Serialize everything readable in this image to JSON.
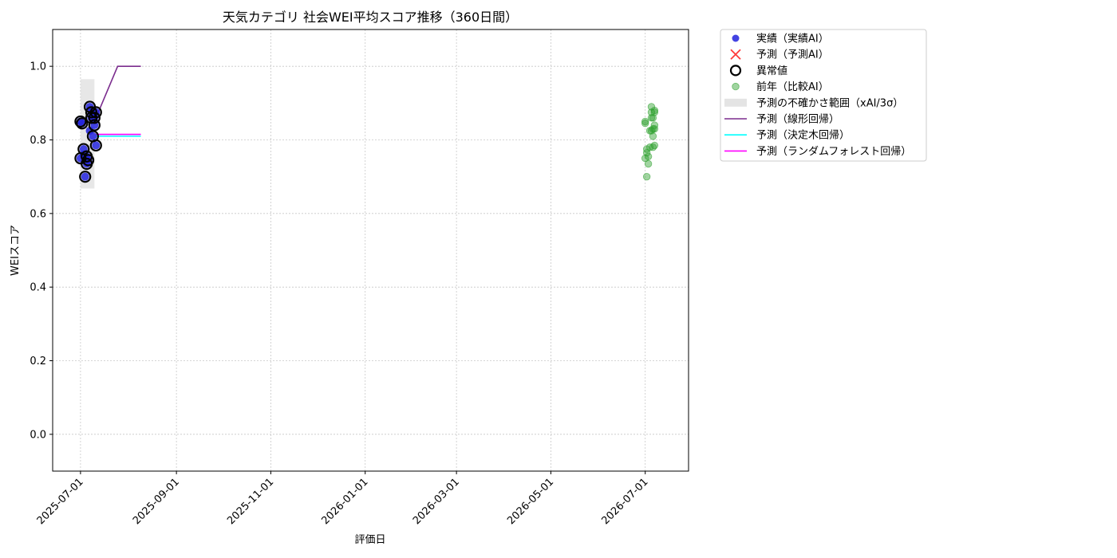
{
  "chart_data": {
    "type": "scatter",
    "title": "天気カテゴリ 社会WEI平均スコア推移（360日間）",
    "xlabel": "評価日",
    "ylabel": "WEIスコア",
    "ylim": [
      -0.1,
      1.1
    ],
    "xlim": [
      "2025-06-13",
      "2026-07-29"
    ],
    "grid": true,
    "legend_position": "outside-right-top",
    "xticks": [
      "2025-07-01",
      "2025-09-01",
      "2025-11-01",
      "2026-01-01",
      "2026-03-01",
      "2026-05-01",
      "2026-07-01"
    ],
    "yticks": [
      "0.0",
      "0.2",
      "0.4",
      "0.6",
      "0.8",
      "1.0"
    ],
    "legend": [
      {
        "key": "actual",
        "label": "実績（実績AI）"
      },
      {
        "key": "pred",
        "label": "予測（予測AI）"
      },
      {
        "key": "anomaly",
        "label": "異常値"
      },
      {
        "key": "prev",
        "label": "前年（比較AI）"
      },
      {
        "key": "band",
        "label": "予測の不確かさ範囲（xAI/3σ）"
      },
      {
        "key": "linear",
        "label": "予測（線形回帰）"
      },
      {
        "key": "tree",
        "label": "予測（決定木回帰）"
      },
      {
        "key": "forest",
        "label": "予測（ランダムフォレスト回帰）"
      }
    ],
    "series": [
      {
        "key": "actual",
        "type": "scatter",
        "color": "#2222dd",
        "points": [
          {
            "x": "2025-07-01",
            "y": 0.85
          },
          {
            "x": "2025-07-02",
            "y": 0.845
          },
          {
            "x": "2025-07-03",
            "y": 0.76
          },
          {
            "x": "2025-07-03",
            "y": 0.775
          },
          {
            "x": "2025-07-04",
            "y": 0.7
          },
          {
            "x": "2025-07-01",
            "y": 0.75
          },
          {
            "x": "2025-07-05",
            "y": 0.755
          },
          {
            "x": "2025-07-05",
            "y": 0.735
          },
          {
            "x": "2025-07-06",
            "y": 0.745
          },
          {
            "x": "2025-07-07",
            "y": 0.89
          },
          {
            "x": "2025-07-08",
            "y": 0.875
          },
          {
            "x": "2025-07-08",
            "y": 0.86
          },
          {
            "x": "2025-07-09",
            "y": 0.81
          },
          {
            "x": "2025-07-09",
            "y": 0.88
          },
          {
            "x": "2025-07-10",
            "y": 0.84
          },
          {
            "x": "2025-07-10",
            "y": 0.86
          },
          {
            "x": "2025-07-11",
            "y": 0.875
          },
          {
            "x": "2025-07-11",
            "y": 0.785
          },
          {
            "x": "2025-07-07",
            "y": 0.825
          }
        ]
      },
      {
        "key": "anomaly",
        "type": "scatter",
        "color": "#000000",
        "points": [
          {
            "x": "2025-07-01",
            "y": 0.85
          },
          {
            "x": "2025-07-02",
            "y": 0.845
          },
          {
            "x": "2025-07-03",
            "y": 0.775
          },
          {
            "x": "2025-07-04",
            "y": 0.7
          },
          {
            "x": "2025-07-01",
            "y": 0.75
          },
          {
            "x": "2025-07-05",
            "y": 0.755
          },
          {
            "x": "2025-07-05",
            "y": 0.735
          },
          {
            "x": "2025-07-06",
            "y": 0.745
          },
          {
            "x": "2025-07-07",
            "y": 0.89
          },
          {
            "x": "2025-07-08",
            "y": 0.875
          },
          {
            "x": "2025-07-08",
            "y": 0.86
          },
          {
            "x": "2025-07-09",
            "y": 0.81
          },
          {
            "x": "2025-07-10",
            "y": 0.84
          },
          {
            "x": "2025-07-10",
            "y": 0.86
          },
          {
            "x": "2025-07-11",
            "y": 0.875
          },
          {
            "x": "2025-07-11",
            "y": 0.785
          }
        ]
      },
      {
        "key": "prev",
        "type": "scatter",
        "color": "#2ca02c",
        "points": [
          {
            "x": "2026-07-01",
            "y": 0.85
          },
          {
            "x": "2026-07-01",
            "y": 0.845
          },
          {
            "x": "2026-07-02",
            "y": 0.765
          },
          {
            "x": "2026-07-02",
            "y": 0.775
          },
          {
            "x": "2026-07-02",
            "y": 0.7
          },
          {
            "x": "2026-07-01",
            "y": 0.75
          },
          {
            "x": "2026-07-03",
            "y": 0.755
          },
          {
            "x": "2026-07-03",
            "y": 0.735
          },
          {
            "x": "2026-07-04",
            "y": 0.78
          },
          {
            "x": "2026-07-05",
            "y": 0.89
          },
          {
            "x": "2026-07-05",
            "y": 0.875
          },
          {
            "x": "2026-07-06",
            "y": 0.86
          },
          {
            "x": "2026-07-06",
            "y": 0.81
          },
          {
            "x": "2026-07-07",
            "y": 0.88
          },
          {
            "x": "2026-07-07",
            "y": 0.84
          },
          {
            "x": "2026-07-05",
            "y": 0.86
          },
          {
            "x": "2026-07-07",
            "y": 0.875
          },
          {
            "x": "2026-07-07",
            "y": 0.785
          },
          {
            "x": "2026-07-04",
            "y": 0.825
          },
          {
            "x": "2026-07-06",
            "y": 0.83
          },
          {
            "x": "2026-07-07",
            "y": 0.83
          },
          {
            "x": "2026-07-06",
            "y": 0.78
          },
          {
            "x": "2026-07-05",
            "y": 0.825
          }
        ]
      },
      {
        "key": "band",
        "type": "band",
        "color": "#dddddd",
        "x0": "2025-07-01",
        "x1": "2025-07-10",
        "y0": 0.668,
        "y1": 0.965
      },
      {
        "key": "linear",
        "type": "line",
        "color": "#7b2d8e",
        "points": [
          {
            "x": "2025-07-11",
            "y": 0.86
          },
          {
            "x": "2025-07-25",
            "y": 1.0
          },
          {
            "x": "2025-08-09",
            "y": 1.0
          }
        ]
      },
      {
        "key": "tree",
        "type": "line",
        "color": "#00ffff",
        "points": [
          {
            "x": "2025-07-11",
            "y": 0.81
          },
          {
            "x": "2025-08-09",
            "y": 0.81
          }
        ]
      },
      {
        "key": "forest",
        "type": "line",
        "color": "#ff00ff",
        "points": [
          {
            "x": "2025-07-11",
            "y": 0.815
          },
          {
            "x": "2025-08-09",
            "y": 0.815
          }
        ]
      }
    ]
  }
}
